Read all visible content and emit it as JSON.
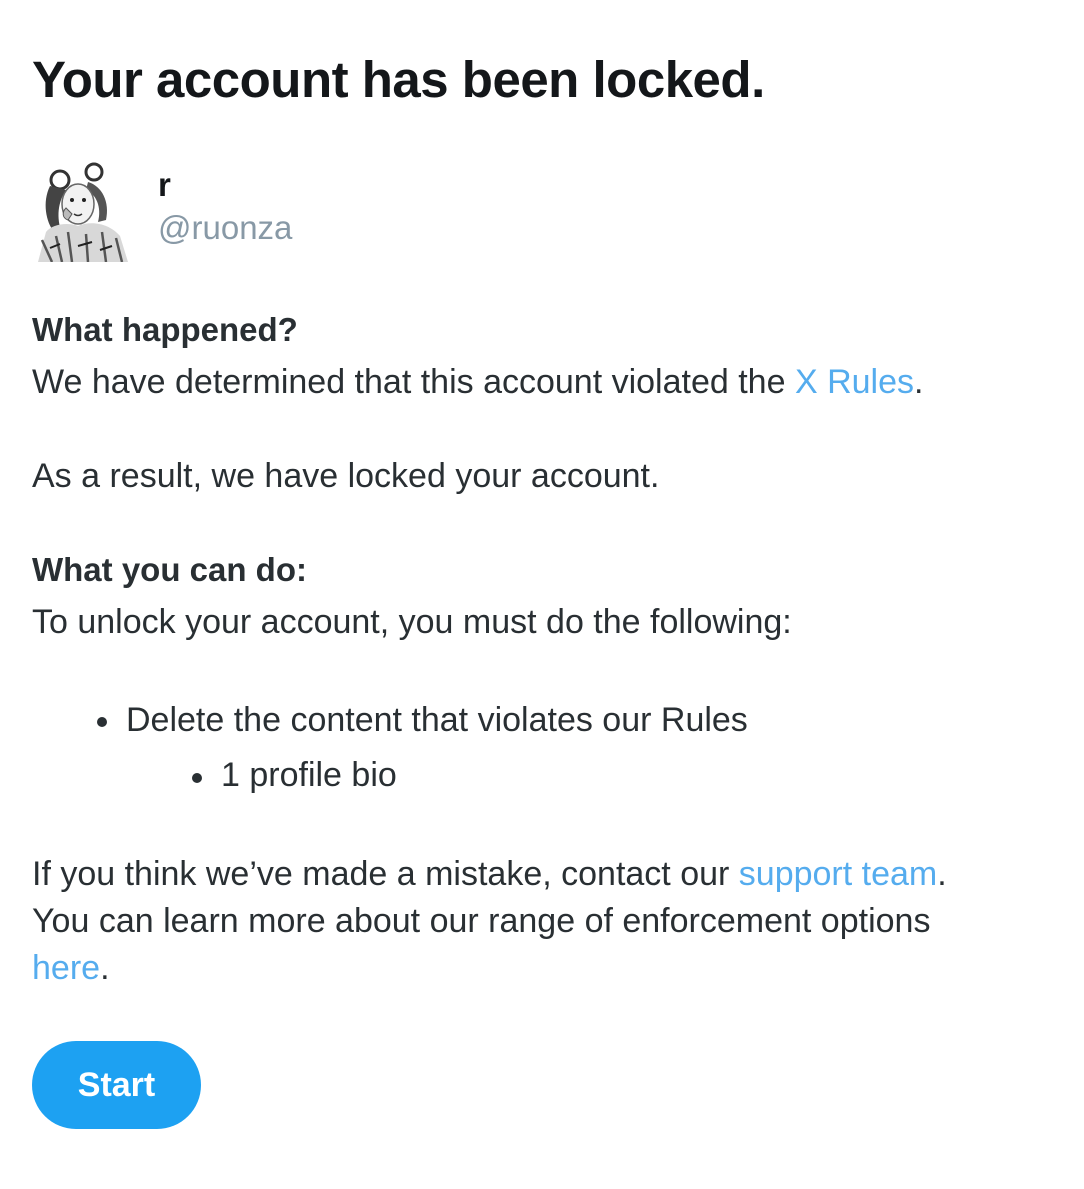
{
  "title": "Your account has been locked.",
  "profile": {
    "display_name": "r",
    "handle": "@ruonza"
  },
  "what_happened": {
    "heading": "What happened?",
    "line_prefix": "We have determined that this account violated the ",
    "rules_link": "X Rules",
    "line_suffix": ".",
    "result": "As a result, we have locked your account."
  },
  "what_you_can_do": {
    "heading": "What you can do:",
    "intro": "To unlock your account, you must do the following:",
    "steps": [
      "Delete the content that violates our Rules"
    ],
    "sub_steps": [
      "1 profile bio"
    ]
  },
  "footer": {
    "mistake_prefix": "If you think we’ve made a mistake, contact our ",
    "support_link": "support team",
    "mistake_suffix": ".",
    "learn_more": "You can learn more about our range of enforcement options",
    "here_link": "here",
    "here_suffix": "."
  },
  "start_button": "Start",
  "colors": {
    "link": "#55acee",
    "button": "#1da1f2",
    "handle": "#8899a6",
    "text": "#292f33"
  }
}
